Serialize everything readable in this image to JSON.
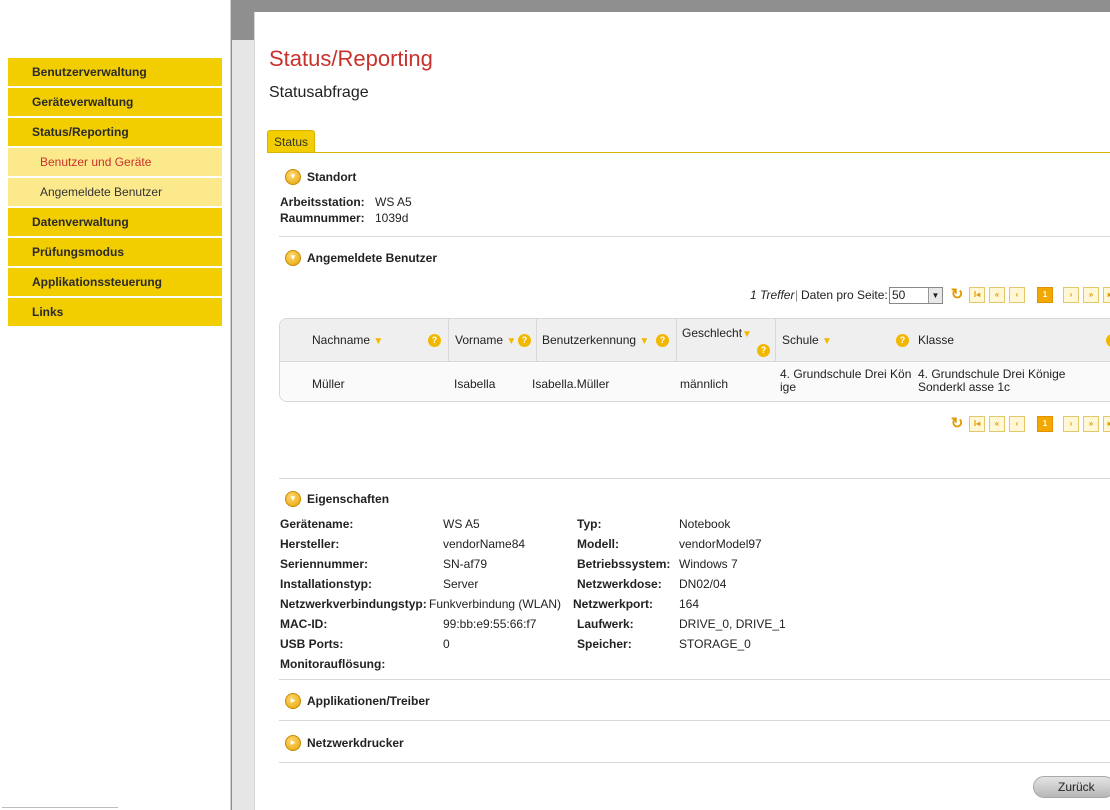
{
  "sidebar": {
    "items": [
      {
        "label": "Benutzerverwaltung"
      },
      {
        "label": "Geräteverwaltung"
      },
      {
        "label": "Status/Reporting"
      },
      {
        "label": "Benutzer und Geräte"
      },
      {
        "label": "Angemeldete Benutzer"
      },
      {
        "label": "Datenverwaltung"
      },
      {
        "label": "Prüfungsmodus"
      },
      {
        "label": "Applikationssteuerung"
      },
      {
        "label": "Links"
      }
    ]
  },
  "page": {
    "title": "Status/Reporting",
    "subtitle": "Statusabfrage",
    "tab": "Status"
  },
  "standort": {
    "heading": "Standort",
    "arbeitsstation_label": "Arbeitsstation:",
    "arbeitsstation_value": "WS A5",
    "raumnummer_label": "Raumnummer:",
    "raumnummer_value": "1039d"
  },
  "angemeldete": {
    "heading": "Angemeldete Benutzer",
    "treffer": "1 Treffer",
    "per_page_label": "Daten pro Seite:",
    "per_page_value": "50",
    "current_page": "1",
    "columns": [
      "Nachname",
      "Vorname",
      "Benutzerkennung",
      "Geschlecht",
      "Schule",
      "Klasse"
    ],
    "rows": [
      [
        "Müller",
        "Isabella",
        "Isabella.Müller",
        "männlich",
        "4. Grundschule Drei Kön ige",
        "4. Grundschule Drei Könige Sonderkl asse 1c"
      ]
    ]
  },
  "eigenschaften": {
    "heading": "Eigenschaften",
    "left": [
      {
        "label": "Gerätename:",
        "value": "WS A5"
      },
      {
        "label": "Hersteller:",
        "value": "vendorName84"
      },
      {
        "label": "Seriennummer:",
        "value": "SN-af79"
      },
      {
        "label": "Installationstyp:",
        "value": "Server"
      },
      {
        "label": "Netzwerkverbindungstyp:",
        "value": "Funkverbindung (WLAN)"
      },
      {
        "label": "MAC-ID:",
        "value": "99:bb:e9:55:66:f7"
      },
      {
        "label": "USB Ports:",
        "value": "0"
      },
      {
        "label": "Monitorauflösung:",
        "value": ""
      }
    ],
    "right": [
      {
        "label": "Typ:",
        "value": "Notebook"
      },
      {
        "label": "Modell:",
        "value": "vendorModel97"
      },
      {
        "label": "Betriebssystem:",
        "value": "Windows 7"
      },
      {
        "label": "Netzwerkdose:",
        "value": "DN02/04"
      },
      {
        "label": "Netzwerkport:",
        "value": "164"
      },
      {
        "label": "Laufwerk:",
        "value": "DRIVE_0, DRIVE_1"
      },
      {
        "label": "Speicher:",
        "value": "STORAGE_0"
      }
    ]
  },
  "applikationen": {
    "heading": "Applikationen/Treiber"
  },
  "netzwerkdrucker": {
    "heading": "Netzwerkdrucker"
  },
  "buttons": {
    "back": "Zurück"
  },
  "colors": {
    "accent": "#f2cd00",
    "title_red": "#c8322d",
    "sub_nav": "#fbe98c"
  }
}
